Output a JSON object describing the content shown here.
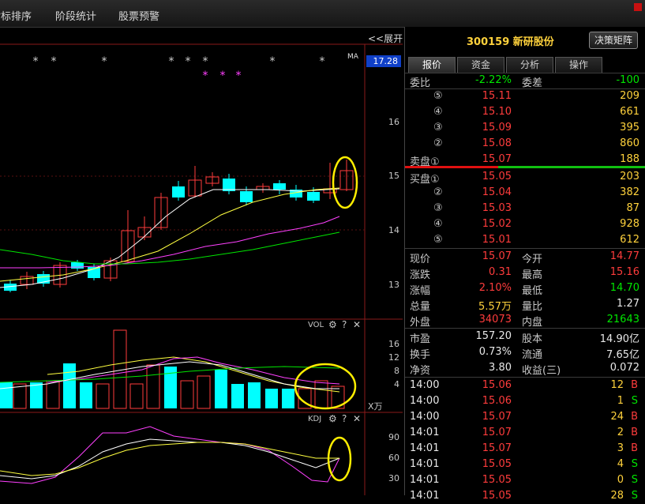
{
  "topbar": {
    "menus": [
      "指标排序",
      "阶段统计",
      "股票预警"
    ]
  },
  "chart": {
    "expand_label": "<<展开",
    "ma_label": "MA",
    "current_price_tag": "17.28",
    "price_ticks": [
      "16",
      "15",
      "14",
      "13"
    ],
    "vol_title": "VOL",
    "vol_ticks": [
      "16",
      "12",
      "8",
      "4"
    ],
    "vol_unit": "X万",
    "kdj_title": "KDJ",
    "kdj_ticks": [
      "90",
      "60",
      "30"
    ],
    "tool_icons": [
      "gear-icon",
      "help-icon",
      "close-icon"
    ],
    "colors": {
      "up": "#ff3c3c",
      "down": "#00ffff",
      "ma5": "#ffffff",
      "ma10": "#ffff40",
      "ma20": "#ff40ff",
      "ma60": "#00e600",
      "highlight": "#ffee00"
    }
  },
  "stock": {
    "title": "300159 新研股份",
    "matrix_button": "决策矩阵",
    "tabs": [
      "报价",
      "资金",
      "分析",
      "操作"
    ],
    "weibi_label": "委比",
    "weibi_value": "-2.22%",
    "weicha_label": "委差",
    "weicha_value": "-100",
    "asks": [
      {
        "label": "⑤",
        "price": "15.11",
        "vol": "209"
      },
      {
        "label": "④",
        "price": "15.10",
        "vol": "661"
      },
      {
        "label": "③",
        "price": "15.09",
        "vol": "395"
      },
      {
        "label": "②",
        "price": "15.08",
        "vol": "860"
      },
      {
        "label": "卖盘①",
        "price": "15.07",
        "vol": "188"
      }
    ],
    "bids": [
      {
        "label": "买盘①",
        "price": "15.05",
        "vol": "203"
      },
      {
        "label": "②",
        "price": "15.04",
        "vol": "382"
      },
      {
        "label": "③",
        "price": "15.03",
        "vol": "87"
      },
      {
        "label": "④",
        "price": "15.02",
        "vol": "928"
      },
      {
        "label": "⑤",
        "price": "15.01",
        "vol": "612"
      }
    ],
    "quotes": [
      {
        "l1": "现价",
        "v1": "15.07",
        "c1": "red",
        "l2": "今开",
        "v2": "14.77",
        "c2": "red"
      },
      {
        "l1": "涨跌",
        "v1": "0.31",
        "c1": "red",
        "l2": "最高",
        "v2": "15.16",
        "c2": "red"
      },
      {
        "l1": "涨幅",
        "v1": "2.10%",
        "c1": "red",
        "l2": "最低",
        "v2": "14.70",
        "c2": "green"
      },
      {
        "l1": "总量",
        "v1": "5.57万",
        "c1": "yellow",
        "l2": "量比",
        "v2": "1.27",
        "c2": "white"
      },
      {
        "l1": "外盘",
        "v1": "34073",
        "c1": "red",
        "l2": "内盘",
        "v2": "21643",
        "c2": "green"
      }
    ],
    "fundamentals": [
      {
        "l1": "市盈",
        "v1": "157.20",
        "l2": "股本",
        "v2": "14.90亿"
      },
      {
        "l1": "换手",
        "v1": "0.73%",
        "l2": "流通",
        "v2": "7.65亿"
      },
      {
        "l1": "净资",
        "v1": "3.80",
        "l2": "收益(三)",
        "v2": "0.072"
      }
    ],
    "ticks": [
      {
        "time": "14:00",
        "price": "15.06",
        "vol": "12",
        "side": "B"
      },
      {
        "time": "14:00",
        "price": "15.06",
        "vol": "1",
        "side": "S"
      },
      {
        "time": "14:00",
        "price": "15.07",
        "vol": "24",
        "side": "B"
      },
      {
        "time": "14:01",
        "price": "15.07",
        "vol": "2",
        "side": "B"
      },
      {
        "time": "14:01",
        "price": "15.07",
        "vol": "3",
        "side": "B"
      },
      {
        "time": "14:01",
        "price": "15.05",
        "vol": "4",
        "side": "S"
      },
      {
        "time": "14:01",
        "price": "15.05",
        "vol": "0",
        "side": "S"
      },
      {
        "time": "14:01",
        "price": "15.05",
        "vol": "28",
        "side": "S"
      }
    ]
  }
}
